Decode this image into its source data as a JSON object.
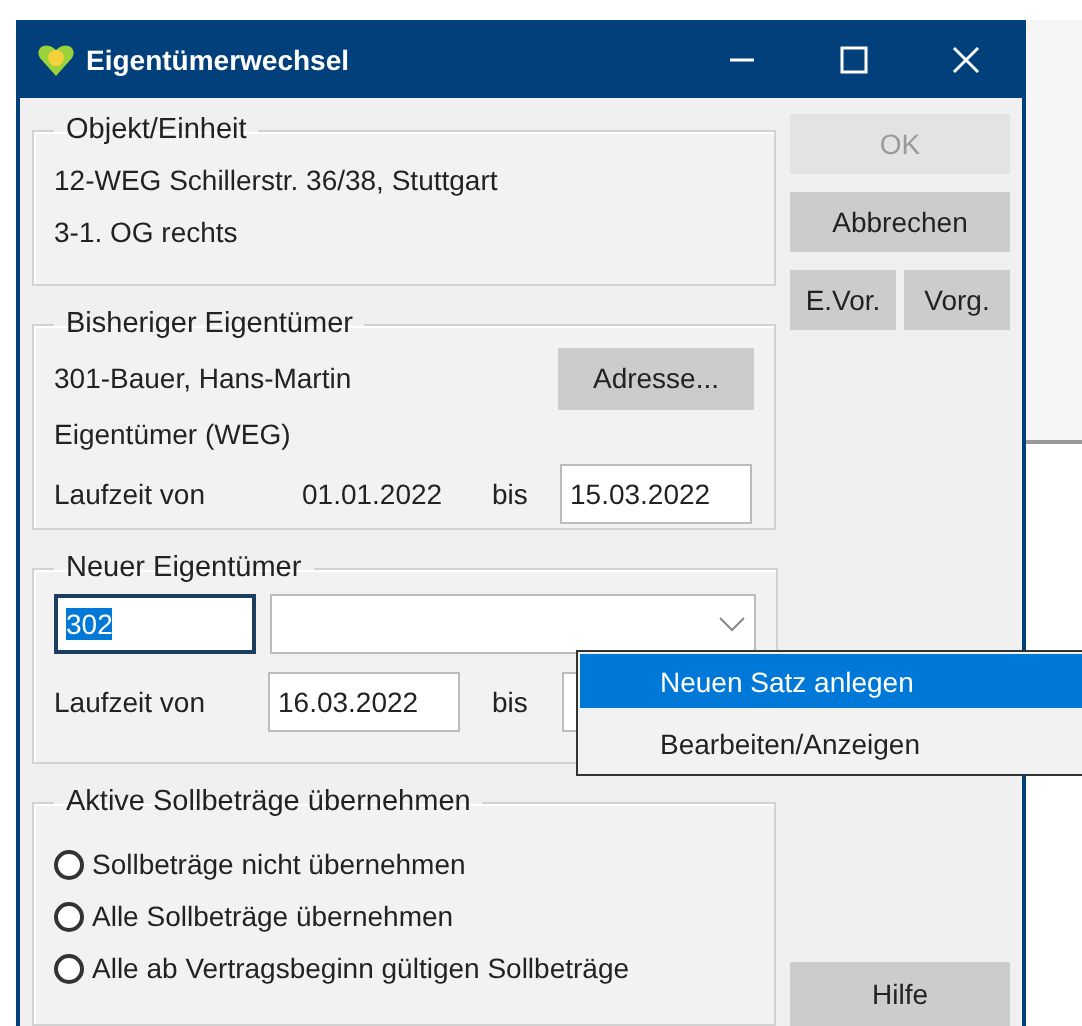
{
  "window": {
    "title": "Eigentümerwechsel"
  },
  "object_unit": {
    "title": "Objekt/Einheit",
    "lines": [
      "12-WEG Schillerstr. 36/38, Stuttgart",
      "3-1. OG rechts"
    ]
  },
  "previous_owner": {
    "title": "Bisheriger Eigentümer",
    "name": "301-Bauer, Hans-Martin",
    "role": "Eigentümer (WEG)",
    "address_button": "Adresse...",
    "period_label": "Laufzeit von",
    "from": "01.01.2022",
    "to_label": "bis",
    "to": "15.03.2022"
  },
  "new_owner": {
    "title": "Neuer Eigentümer",
    "number": "302",
    "period_label": "Laufzeit von",
    "from": "16.03.2022",
    "to_label": "bis"
  },
  "context_menu": [
    {
      "label": "Neuen Satz anlegen",
      "selected": true
    },
    {
      "label": "Bearbeiten/Anzeigen",
      "selected": false
    }
  ],
  "transfer": {
    "title": "Aktive Sollbeträge übernehmen",
    "options": [
      {
        "label": "Sollbeträge nicht übernehmen",
        "selected": false
      },
      {
        "label": "Alle Sollbeträge übernehmen",
        "selected": false
      },
      {
        "label": "Alle ab Vertragsbeginn gültigen Sollbeträge",
        "selected": false
      }
    ]
  },
  "buttons": [
    {
      "label": "OK",
      "disabled": true
    },
    {
      "label": "Abbrechen",
      "disabled": false
    }
  ],
  "small_buttons": [
    "E.Vor.",
    "Vorg."
  ],
  "help_button": "Hilfe"
}
